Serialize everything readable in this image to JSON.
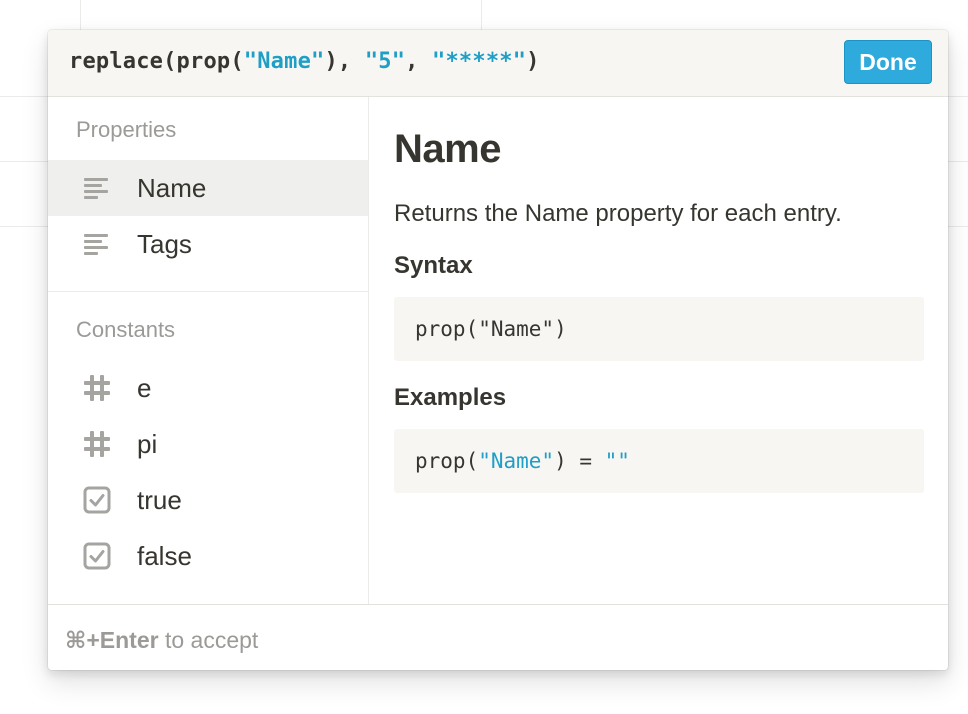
{
  "formula": {
    "prefix": "replace(prop(",
    "arg_name": "\"Name\"",
    "mid1": "), ",
    "arg_find": "\"5\"",
    "mid2": ", ",
    "arg_replace": "\"*****\"",
    "suffix": ")"
  },
  "done_label": "Done",
  "sidebar": {
    "properties_heading": "Properties",
    "properties": [
      {
        "label": "Name",
        "icon": "text-lines-icon",
        "selected": true
      },
      {
        "label": "Tags",
        "icon": "text-lines-icon",
        "selected": false
      }
    ],
    "constants_heading": "Constants",
    "constants": [
      {
        "label": "e",
        "icon": "hash-icon"
      },
      {
        "label": "pi",
        "icon": "hash-icon"
      },
      {
        "label": "true",
        "icon": "checkbox-icon"
      },
      {
        "label": "false",
        "icon": "checkbox-icon"
      }
    ]
  },
  "detail": {
    "title": "Name",
    "description": "Returns the Name property for each entry.",
    "syntax_heading": "Syntax",
    "syntax_code": "prop(\"Name\")",
    "examples_heading": "Examples",
    "example": {
      "prefix": "prop(",
      "arg": "\"Name\"",
      "suffix": ") = ",
      "value": "\"\""
    }
  },
  "footer": {
    "shortcut": "⌘+Enter",
    "text": " to accept"
  },
  "colors": {
    "accent": "#2eaadc",
    "string_literal": "#1f9ec6",
    "muted_text": "#9b9a97",
    "selected_row": "#efefee",
    "code_bg": "#f7f6f3"
  }
}
